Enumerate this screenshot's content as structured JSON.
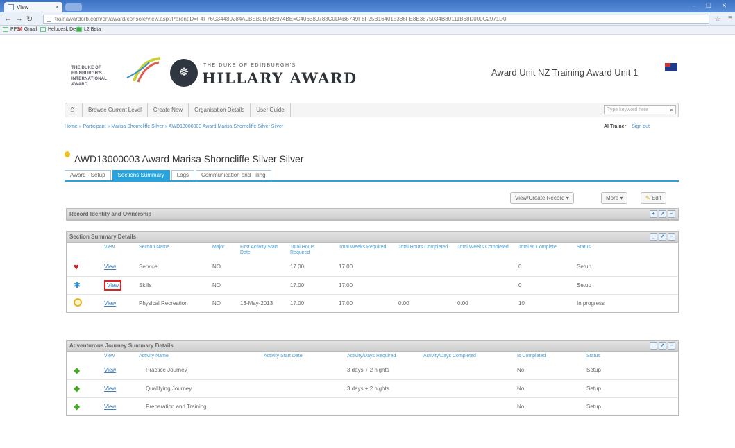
{
  "browser": {
    "tab_title": "View",
    "tab_close": "×",
    "url": "trainawardorb.com/en/award/console/view.asp?ParentID=F4F76C34480284A0BEB0B7B8974BE=C406380783C0D4B6749F8F25B164015386FE8E3875034B80111B68D000C2971D0",
    "bookmarks": [
      "PPS",
      "Gmail",
      "Helpdesk Deal",
      "L2 Beta"
    ],
    "window_controls": "– ☐ ✕"
  },
  "header": {
    "logo_text": "THE DUKE OF EDINBURGH'S INTERNATIONAL AWARD",
    "brand_small": "THE DUKE OF EDINBURGH'S",
    "brand_big": "HILLARY AWARD",
    "unit_title": "Award Unit NZ Training Award Unit 1"
  },
  "nav": {
    "items": [
      "Browse Current Level",
      "Create New",
      "Organisation Details",
      "User Guide"
    ],
    "search_placeholder": "Type keyword here"
  },
  "breadcrumb": "Home » Participant » Marisa Shorncliffe Silver » AWD13000003 Award Marisa Shorncliffe Silver Silver",
  "user": {
    "name": "AI Trainer",
    "signout": "Sign out"
  },
  "page_title": "AWD13000003 Award Marisa Shorncliffe Silver Silver",
  "tabs": [
    "Award - Setup",
    "Sections Summary",
    "Logs",
    "Communication and Filing"
  ],
  "actions": {
    "view_create": "View/Create Record",
    "more": "More",
    "edit": "Edit"
  },
  "panels": {
    "record": {
      "title": "Record Identity and Ownership"
    },
    "sections": {
      "title": "Section Summary Details",
      "headers": [
        "View",
        "Section Name",
        "Major",
        "First Activity Start Date",
        "Total Hours Required",
        "Total Weeks Required",
        "Total Hours Completed",
        "Total Weeks Completed",
        "Total % Complete",
        "Status"
      ],
      "rows": [
        {
          "icon": "heart-icon",
          "view": "View",
          "name": "Service",
          "major": "NO",
          "start": "",
          "hours_req": "17.00",
          "weeks_req": "17.00",
          "hours_done": "",
          "weeks_done": "",
          "pct": "0",
          "status": "Setup"
        },
        {
          "icon": "puzzle-icon",
          "view": "View",
          "name": "Skills",
          "major": "NO",
          "start": "",
          "hours_req": "17.00",
          "weeks_req": "17.00",
          "hours_done": "",
          "weeks_done": "",
          "pct": "0",
          "status": "Setup"
        },
        {
          "icon": "running-icon",
          "view": "View",
          "name": "Physical Recreation",
          "major": "NO",
          "start": "13-May-2013",
          "hours_req": "17.00",
          "weeks_req": "17.00",
          "hours_done": "0.00",
          "weeks_done": "0.00",
          "pct": "10",
          "status": "In progress"
        }
      ]
    },
    "journeys": {
      "title": "Adventurous Journey Summary Details",
      "headers": [
        "View",
        "Activity Name",
        "Activity Start Date",
        "Activity/Days Required",
        "Activity/Days Completed",
        "Is Completed",
        "Status"
      ],
      "rows": [
        {
          "view": "View",
          "name": "Practice Journey",
          "start": "",
          "required": "3 days + 2 nights",
          "completed": "",
          "is_completed": "No",
          "status": "Setup"
        },
        {
          "view": "View",
          "name": "Qualifying Journey",
          "start": "",
          "required": "3 days + 2 nights",
          "completed": "",
          "is_completed": "No",
          "status": "Setup"
        },
        {
          "view": "View",
          "name": "Preparation and Training",
          "start": "",
          "required": "",
          "completed": "",
          "is_completed": "No",
          "status": "Setup"
        }
      ]
    }
  }
}
